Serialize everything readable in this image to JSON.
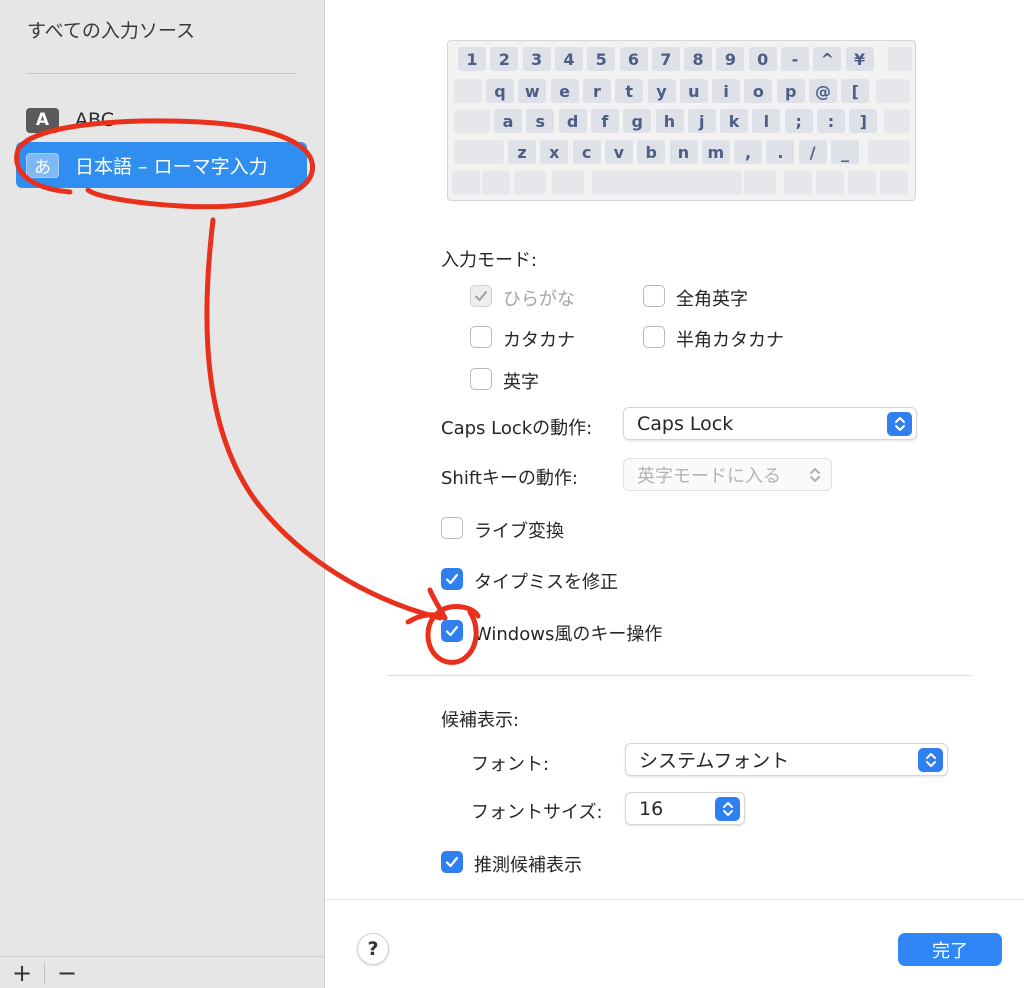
{
  "sidebar": {
    "title": "すべての入力ソース",
    "items": [
      {
        "icon_text": "A",
        "label": "ABC",
        "selected": false
      },
      {
        "icon_text": "あ",
        "label": "日本語 – ローマ字入力",
        "selected": true
      }
    ],
    "add_label": "+",
    "remove_label": "−"
  },
  "keyboard": {
    "rows": [
      [
        "1",
        "2",
        "3",
        "4",
        "5",
        "6",
        "7",
        "8",
        "9",
        "0",
        "-",
        "^",
        "¥"
      ],
      [
        "q",
        "w",
        "e",
        "r",
        "t",
        "y",
        "u",
        "i",
        "o",
        "p",
        "@",
        "["
      ],
      [
        "a",
        "s",
        "d",
        "f",
        "g",
        "h",
        "j",
        "k",
        "l",
        ";",
        ":",
        "]"
      ],
      [
        "z",
        "x",
        "c",
        "v",
        "b",
        "n",
        "m",
        ",",
        ".",
        "/",
        "_"
      ]
    ]
  },
  "input_mode": {
    "label": "入力モード:",
    "options": {
      "hiragana": {
        "label": "ひらがな",
        "checked": true,
        "disabled": true
      },
      "zenkaku_eiji": {
        "label": "全角英字",
        "checked": false
      },
      "katakana": {
        "label": "カタカナ",
        "checked": false
      },
      "hankaku_katakana": {
        "label": "半角カタカナ",
        "checked": false
      },
      "eiji": {
        "label": "英字",
        "checked": false
      }
    }
  },
  "caps_lock": {
    "label": "Caps Lockの動作:",
    "value": "Caps Lock"
  },
  "shift": {
    "label": "Shiftキーの動作:",
    "value": "英字モードに入る"
  },
  "options": {
    "live_conversion": {
      "label": "ライブ変換",
      "checked": false
    },
    "typo_correction": {
      "label": "タイプミスを修正",
      "checked": true
    },
    "windows_keys": {
      "label": "Windows風のキー操作",
      "checked": true
    }
  },
  "candidates": {
    "label": "候補表示:",
    "font_label": "フォント:",
    "font_value": "システムフォント",
    "font_size_label": "フォントサイズ:",
    "font_size_value": "16",
    "predictive": {
      "label": "推測候補表示",
      "checked": true
    }
  },
  "footer": {
    "help_label": "?",
    "done_label": "完了"
  },
  "colors": {
    "accent": "#2f7ff0",
    "annotation": "#e8301c",
    "selected_row": "#2f8ef0"
  }
}
